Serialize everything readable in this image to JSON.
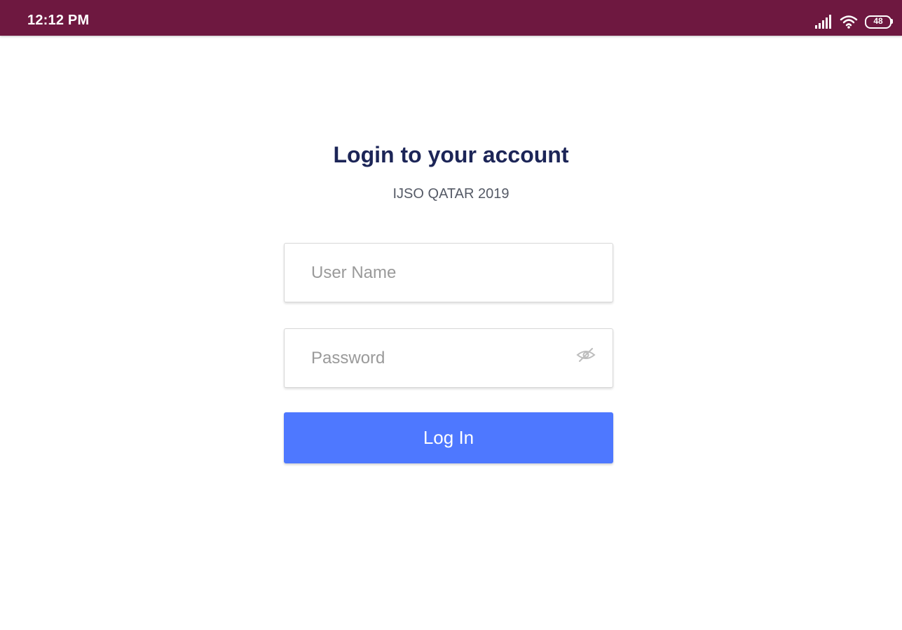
{
  "status_bar": {
    "time": "12:12 PM",
    "battery": "48",
    "icons": [
      "signal-icon",
      "wifi-icon",
      "battery-icon"
    ],
    "background_color": "#6e1840"
  },
  "login": {
    "title": "Login to your account",
    "subtitle": "IJSO QATAR 2019",
    "username": {
      "placeholder": "User Name",
      "value": ""
    },
    "password": {
      "placeholder": "Password",
      "value": "",
      "toggle_icon": "eye-off-icon"
    },
    "submit_label": "Log In",
    "accent_color": "#4e78ff",
    "title_color": "#1c2557"
  }
}
